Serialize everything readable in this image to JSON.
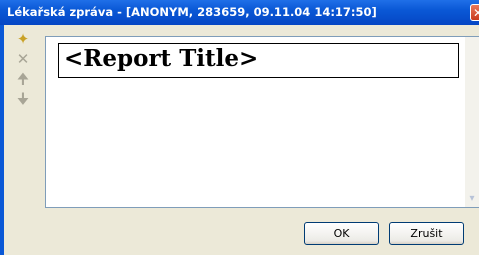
{
  "window": {
    "title": "Lékařská zpráva - [ANONYM, 283659, 09.11.04 14:17:50]",
    "close_glyph": "✕"
  },
  "toolbar": {
    "items": [
      {
        "name": "new-item-icon",
        "glyph": "✦"
      },
      {
        "name": "delete-icon",
        "glyph": "✕"
      },
      {
        "name": "move-up-icon",
        "glyph": "🠉"
      },
      {
        "name": "move-down-icon",
        "glyph": "🠋"
      }
    ]
  },
  "editor": {
    "report_title": "<Report Title>"
  },
  "buttons": {
    "ok_label": "OK",
    "cancel_label": "Zrušit"
  },
  "colors": {
    "titlebar": "#0a58d6",
    "client_bg": "#ece9d8",
    "close_button": "#c93a1d"
  }
}
